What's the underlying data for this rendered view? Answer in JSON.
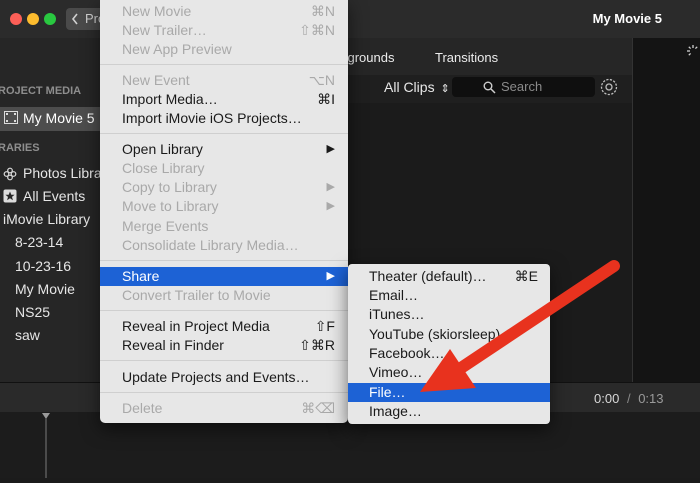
{
  "window": {
    "back_label": "Pro",
    "title": "My Movie 5"
  },
  "sidebar": {
    "project_media_header": "ROJECT MEDIA",
    "project_item": "My Movie 5",
    "libraries_header": "RARIES",
    "items": [
      {
        "label": "Photos Librar",
        "icon": "photos-icon"
      },
      {
        "label": "All Events",
        "icon": "star-icon"
      },
      {
        "label": "iMovie Library",
        "icon": ""
      },
      {
        "label": "8-23-14",
        "icon": ""
      },
      {
        "label": "10-23-16",
        "icon": ""
      },
      {
        "label": "My Movie",
        "icon": ""
      },
      {
        "label": "NS25",
        "icon": ""
      },
      {
        "label": "saw",
        "icon": ""
      }
    ]
  },
  "browser": {
    "tabs": [
      "kgrounds",
      "Transitions"
    ],
    "filter_label": "All Clips",
    "search_placeholder": "Search"
  },
  "timeline": {
    "current": "0:00",
    "sep": "/",
    "total": "0:13"
  },
  "file_menu": {
    "items": [
      {
        "label": "New Movie",
        "shortcut": "⌘N",
        "enabled": false
      },
      {
        "label": "New Trailer…",
        "shortcut": "⇧⌘N",
        "enabled": false
      },
      {
        "label": "New App Preview",
        "shortcut": "",
        "enabled": false
      },
      {
        "label": "New Event",
        "shortcut": "⌥N",
        "enabled": false
      },
      {
        "label": "Import Media…",
        "shortcut": "⌘I",
        "enabled": true
      },
      {
        "label": "Import iMovie iOS Projects…",
        "shortcut": "",
        "enabled": true
      },
      {
        "label": "Open Library",
        "shortcut": "▶",
        "enabled": true
      },
      {
        "label": "Close Library",
        "shortcut": "",
        "enabled": false
      },
      {
        "label": "Copy to Library",
        "shortcut": "▶",
        "enabled": false
      },
      {
        "label": "Move to Library",
        "shortcut": "▶",
        "enabled": false
      },
      {
        "label": "Merge Events",
        "shortcut": "",
        "enabled": false
      },
      {
        "label": "Consolidate Library Media…",
        "shortcut": "",
        "enabled": false
      },
      {
        "label": "Share",
        "shortcut": "▶",
        "enabled": true,
        "highlighted": true
      },
      {
        "label": "Convert Trailer to Movie",
        "shortcut": "",
        "enabled": false
      },
      {
        "label": "Reveal in Project Media",
        "shortcut": "⇧F",
        "enabled": true
      },
      {
        "label": "Reveal in Finder",
        "shortcut": "⇧⌘R",
        "enabled": true
      },
      {
        "label": "Update Projects and Events…",
        "shortcut": "",
        "enabled": true
      },
      {
        "label": "Delete",
        "shortcut": "⌘⌫",
        "enabled": false
      }
    ]
  },
  "share_menu": {
    "items": [
      {
        "label": "Theater (default)…",
        "shortcut": "⌘E"
      },
      {
        "label": "Email…",
        "shortcut": ""
      },
      {
        "label": "iTunes…",
        "shortcut": ""
      },
      {
        "label": "YouTube (skiorsleep)…",
        "shortcut": ""
      },
      {
        "label": "Facebook…",
        "shortcut": ""
      },
      {
        "label": "Vimeo…",
        "shortcut": ""
      },
      {
        "label": "File…",
        "shortcut": "",
        "highlighted": true
      },
      {
        "label": "Image…",
        "shortcut": ""
      }
    ]
  },
  "colors": {
    "highlight": "#1d62d5",
    "arrow": "#e8321e"
  }
}
